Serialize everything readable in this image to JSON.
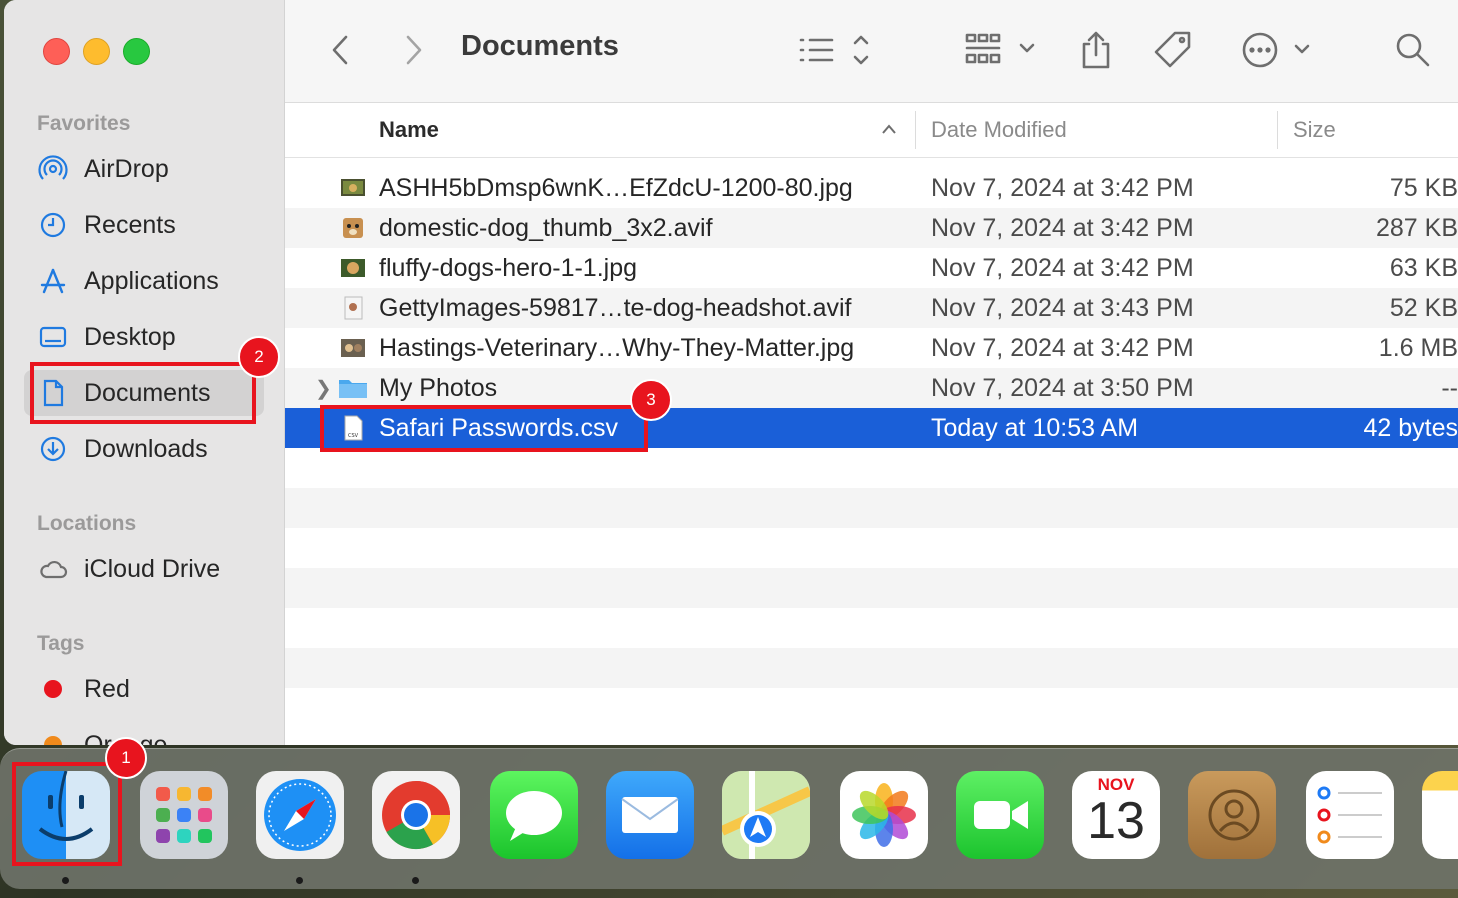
{
  "window": {
    "title": "Documents"
  },
  "sidebar": {
    "favorites_label": "Favorites",
    "favorites": [
      {
        "label": "AirDrop",
        "icon": "airdrop-icon"
      },
      {
        "label": "Recents",
        "icon": "clock-icon"
      },
      {
        "label": "Applications",
        "icon": "applications-icon"
      },
      {
        "label": "Desktop",
        "icon": "desktop-icon"
      },
      {
        "label": "Documents",
        "icon": "document-icon",
        "active": true
      },
      {
        "label": "Downloads",
        "icon": "download-icon"
      }
    ],
    "locations_label": "Locations",
    "locations": [
      {
        "label": "iCloud Drive",
        "icon": "cloud-icon"
      }
    ],
    "tags_label": "Tags",
    "tags": [
      {
        "label": "Red",
        "color": "#e8141e"
      },
      {
        "label": "Orange",
        "color": "#f08a1c"
      }
    ]
  },
  "columns": {
    "name": "Name",
    "date": "Date Modified",
    "size": "Size"
  },
  "files": [
    {
      "name": "ASHH5bDmsp6wnK…EfZdcU-1200-80.jpg",
      "date": "Nov 7, 2024 at 3:42 PM",
      "size": "75 KB"
    },
    {
      "name": "domestic-dog_thumb_3x2.avif",
      "date": "Nov 7, 2024 at 3:42 PM",
      "size": "287 KB"
    },
    {
      "name": "fluffy-dogs-hero-1-1.jpg",
      "date": "Nov 7, 2024 at 3:42 PM",
      "size": "63 KB"
    },
    {
      "name": "GettyImages-59817…te-dog-headshot.avif",
      "date": "Nov 7, 2024 at 3:43 PM",
      "size": "52 KB"
    },
    {
      "name": "Hastings-Veterinary…Why-They-Matter.jpg",
      "date": "Nov 7, 2024 at 3:42 PM",
      "size": "1.6 MB"
    },
    {
      "name": "My Photos",
      "date": "Nov 7, 2024 at 3:50 PM",
      "size": "--",
      "folder": true
    },
    {
      "name": "Safari Passwords.csv",
      "date": "Today at 10:53 AM",
      "size": "42 bytes",
      "selected": true
    }
  ],
  "annotations": [
    {
      "label": "1"
    },
    {
      "label": "2"
    },
    {
      "label": "3"
    }
  ],
  "dock": {
    "apps": [
      "Finder",
      "Launchpad",
      "Safari",
      "Chrome",
      "Messages",
      "Mail",
      "Maps",
      "Photos",
      "FaceTime",
      "Calendar",
      "Contacts",
      "Reminders",
      "Notes"
    ],
    "calendar_month": "NOV",
    "calendar_day": "13"
  }
}
